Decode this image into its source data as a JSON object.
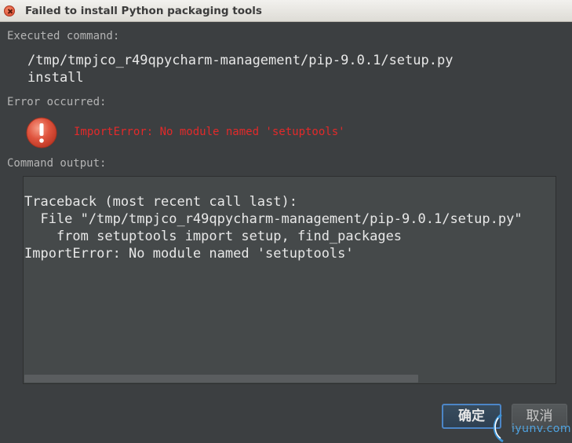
{
  "window": {
    "title": "Failed to install Python packaging tools"
  },
  "sections": {
    "executed_label": "Executed command:",
    "command": "/tmp/tmpjco_r49qpycharm-management/pip-9.0.1/setup.py\ninstall",
    "error_label": "Error occurred:",
    "error_message": "ImportError: No module named 'setuptools'",
    "output_label": "Command output:",
    "output": "Traceback (most recent call last):\n  File \"/tmp/tmpjco_r49qpycharm-management/pip-9.0.1/setup.py\"\n    from setuptools import setup, find_packages\nImportError: No module named 'setuptools'"
  },
  "buttons": {
    "ok": "确定",
    "cancel": "取消"
  },
  "watermark": {
    "text": "iyunv.com"
  },
  "colors": {
    "background": "#3c3f41",
    "error_text": "#e22a2a",
    "accent": "#4c86c7"
  }
}
